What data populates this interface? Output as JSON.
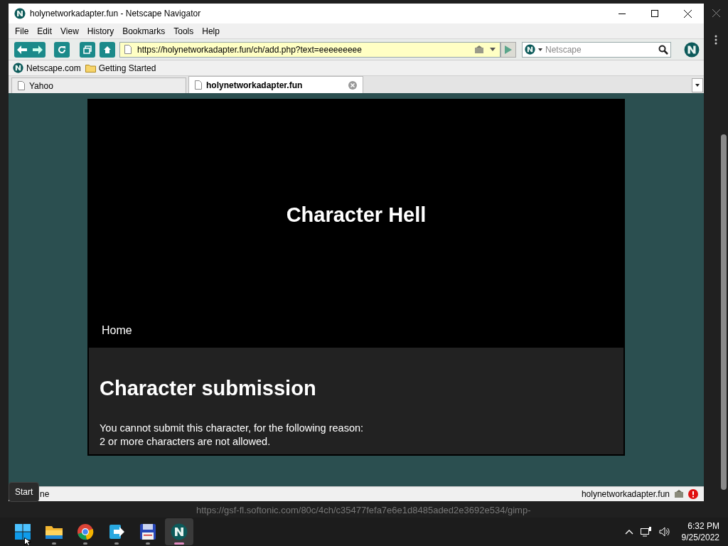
{
  "window": {
    "title": "holynetworkadapter.fun - Netscape Navigator"
  },
  "menu": [
    "File",
    "Edit",
    "View",
    "History",
    "Bookmarks",
    "Tools",
    "Help"
  ],
  "address": {
    "value": "https://holynetworkadapter.fun/ch/add.php?text=eeeeeeeee"
  },
  "search": {
    "placeholder": "Netscape"
  },
  "bookmarks": [
    {
      "label": "Netscape.com",
      "kind": "site"
    },
    {
      "label": "Getting Started",
      "kind": "folder"
    }
  ],
  "tabs": [
    {
      "label": "Yahoo",
      "selected": false
    },
    {
      "label": "holynetworkadapter.fun",
      "selected": true
    }
  ],
  "page": {
    "site_title": "Character Hell",
    "nav": [
      "Home"
    ],
    "heading": "Character submission",
    "lines": [
      "You cannot submit this character, for the following reason:",
      "2 or more characters are not allowed."
    ]
  },
  "status_bar": {
    "text": "ne",
    "domain": "holynetworkadapter.fun"
  },
  "behind_text": "https://gsf-fl.softonic.com/80c/4ch/c35477fefa7e6e1d8485aded2e3692e534/gimp-",
  "tooltip": "Start",
  "taskbar": {
    "apps": [
      {
        "kind": "start",
        "selected": false
      },
      {
        "kind": "folder",
        "selected": false
      },
      {
        "kind": "chrome",
        "selected": false
      },
      {
        "kind": "transfer",
        "selected": false
      },
      {
        "kind": "floppy",
        "selected": false
      },
      {
        "kind": "netscape",
        "selected": true
      }
    ],
    "time": "6:32 PM",
    "date": "9/25/2022"
  }
}
